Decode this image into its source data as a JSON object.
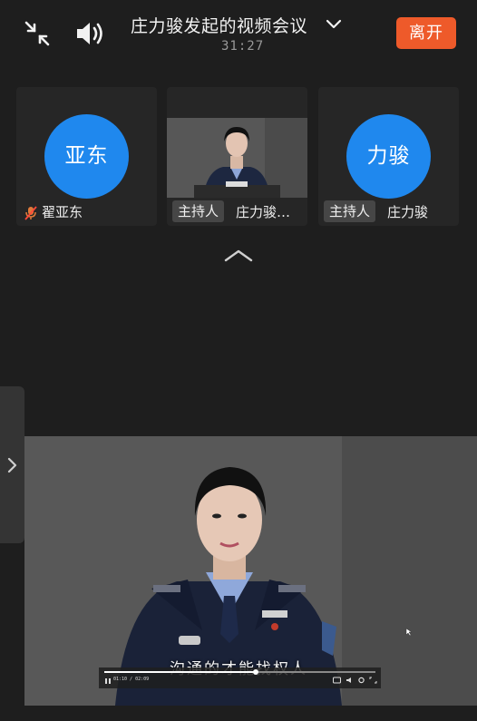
{
  "header": {
    "title": "庄力骏发起的视频会议",
    "timer": "31:27",
    "leave_label": "离开"
  },
  "participants": [
    {
      "avatar_text": "亚东",
      "name": "翟亚东",
      "muted": true
    },
    {
      "host_label": "主持人",
      "name": "庄力骏…",
      "has_video": true
    },
    {
      "avatar_text": "力骏",
      "host_label": "主持人",
      "name": "庄力骏"
    }
  ],
  "main_video": {
    "subtitle": "沟通的才能找权人",
    "player_time": "01:10 / 02:09",
    "progress_fraction": 0.56
  },
  "colors": {
    "leave_button": "#ee5a2a",
    "avatar": "#1f88ee",
    "background": "#1e1e1e"
  },
  "icons": [
    "minimize-arrows-icon",
    "speaker-icon",
    "chevron-down-icon",
    "mute-mic-icon",
    "chevron-up-icon",
    "chevron-right-icon",
    "play-pause-icon",
    "cc-icon",
    "volume-icon",
    "settings-icon",
    "fullscreen-icon"
  ]
}
